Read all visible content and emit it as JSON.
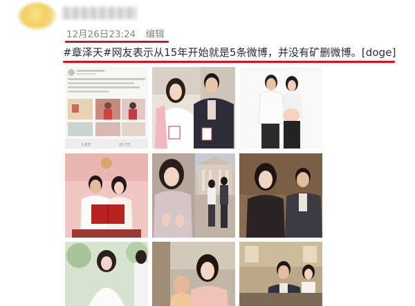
{
  "post": {
    "username": "",
    "timestamp": "12月26日23:24",
    "edit_label": "编辑",
    "text_tag": "#章泽天#",
    "text_body": "网友表示从15年开始就是5条微博，并没有矿删微博。",
    "text_emoji": "[doge]",
    "images": [
      {
        "name": "weibo-screenshot"
      },
      {
        "name": "couple-portrait-pink-coat"
      },
      {
        "name": "pregnancy-photo"
      },
      {
        "name": "marriage-certificate-photo"
      },
      {
        "name": "woman-portrait-campus"
      },
      {
        "name": "woman-portrait-smiling"
      },
      {
        "name": "wedding-photo"
      },
      {
        "name": "woman-with-child"
      },
      {
        "name": "couple-event-photo"
      }
    ],
    "embedded_card": {
      "footer_left": "1.6万",
      "footer_right": "23.7万"
    }
  },
  "colors": {
    "underline": "#cf1424",
    "meta_text": "#858585",
    "post_text": "#2a2a2a"
  }
}
